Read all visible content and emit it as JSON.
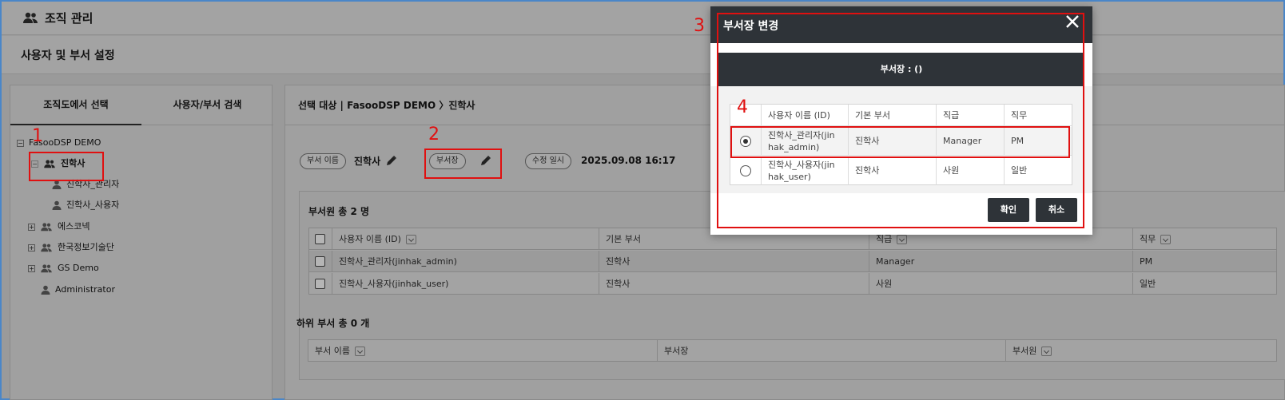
{
  "header": {
    "title": "조직 관리",
    "icon": "people-icon"
  },
  "subheader": {
    "title": "사용자 및 부서 설정"
  },
  "left_panel": {
    "tabs": [
      {
        "label": "조직도에서 선택"
      },
      {
        "label": "사용자/부서 검색"
      }
    ],
    "tree": {
      "root": "FasooDSP DEMO",
      "items": [
        {
          "label": "진학사"
        },
        {
          "label": "진학사_관리자"
        },
        {
          "label": "진학사_사용자"
        },
        {
          "label": "에스코넥"
        },
        {
          "label": "한국정보기술단"
        },
        {
          "label": "GS Demo"
        },
        {
          "label": "Administrator"
        }
      ]
    }
  },
  "target": {
    "text": "선택 대상  |  FasooDSP DEMO 〉진학사"
  },
  "fields": {
    "dept_name_label": "부서 이름",
    "dept_name_value": "진학사",
    "dept_head_label": "부서장",
    "modified_label": "수정 일시",
    "modified_value": "2025.09.08 16:17"
  },
  "members": {
    "title": "부서원   총 2 명",
    "columns": [
      "사용자 이름 (ID)",
      "기본 부서",
      "직급",
      "직무"
    ],
    "rows": [
      [
        "진학사_관리자(jinhak_admin)",
        "진학사",
        "Manager",
        "PM"
      ],
      [
        "진학사_사용자(jinhak_user)",
        "진학사",
        "사원",
        "일반"
      ]
    ]
  },
  "sub_depts": {
    "title": "하위 부서   총 0 개",
    "columns": [
      "부서 이름",
      "부서장",
      "부서원"
    ]
  },
  "annotations": {
    "n1": "1",
    "n2": "2",
    "n3": "3",
    "n4": "4",
    "color": "#e01010"
  },
  "modal": {
    "title": "부서장 변경",
    "banner": "부서장 : ()",
    "columns": [
      "사용자 이름 (ID)",
      "기본 부서",
      "직급",
      "직무"
    ],
    "rows": [
      {
        "name_line1": "진학사_관리자(jin",
        "name_line2": "hak_admin)",
        "dept": "진학사",
        "rank": "Manager",
        "duty": "PM",
        "selected": true
      },
      {
        "name_line1": "진학사_사용자(jin",
        "name_line2": "hak_user)",
        "dept": "진학사",
        "rank": "사원",
        "duty": "일반",
        "selected": false
      }
    ],
    "confirm": "확인",
    "cancel": "취소"
  }
}
